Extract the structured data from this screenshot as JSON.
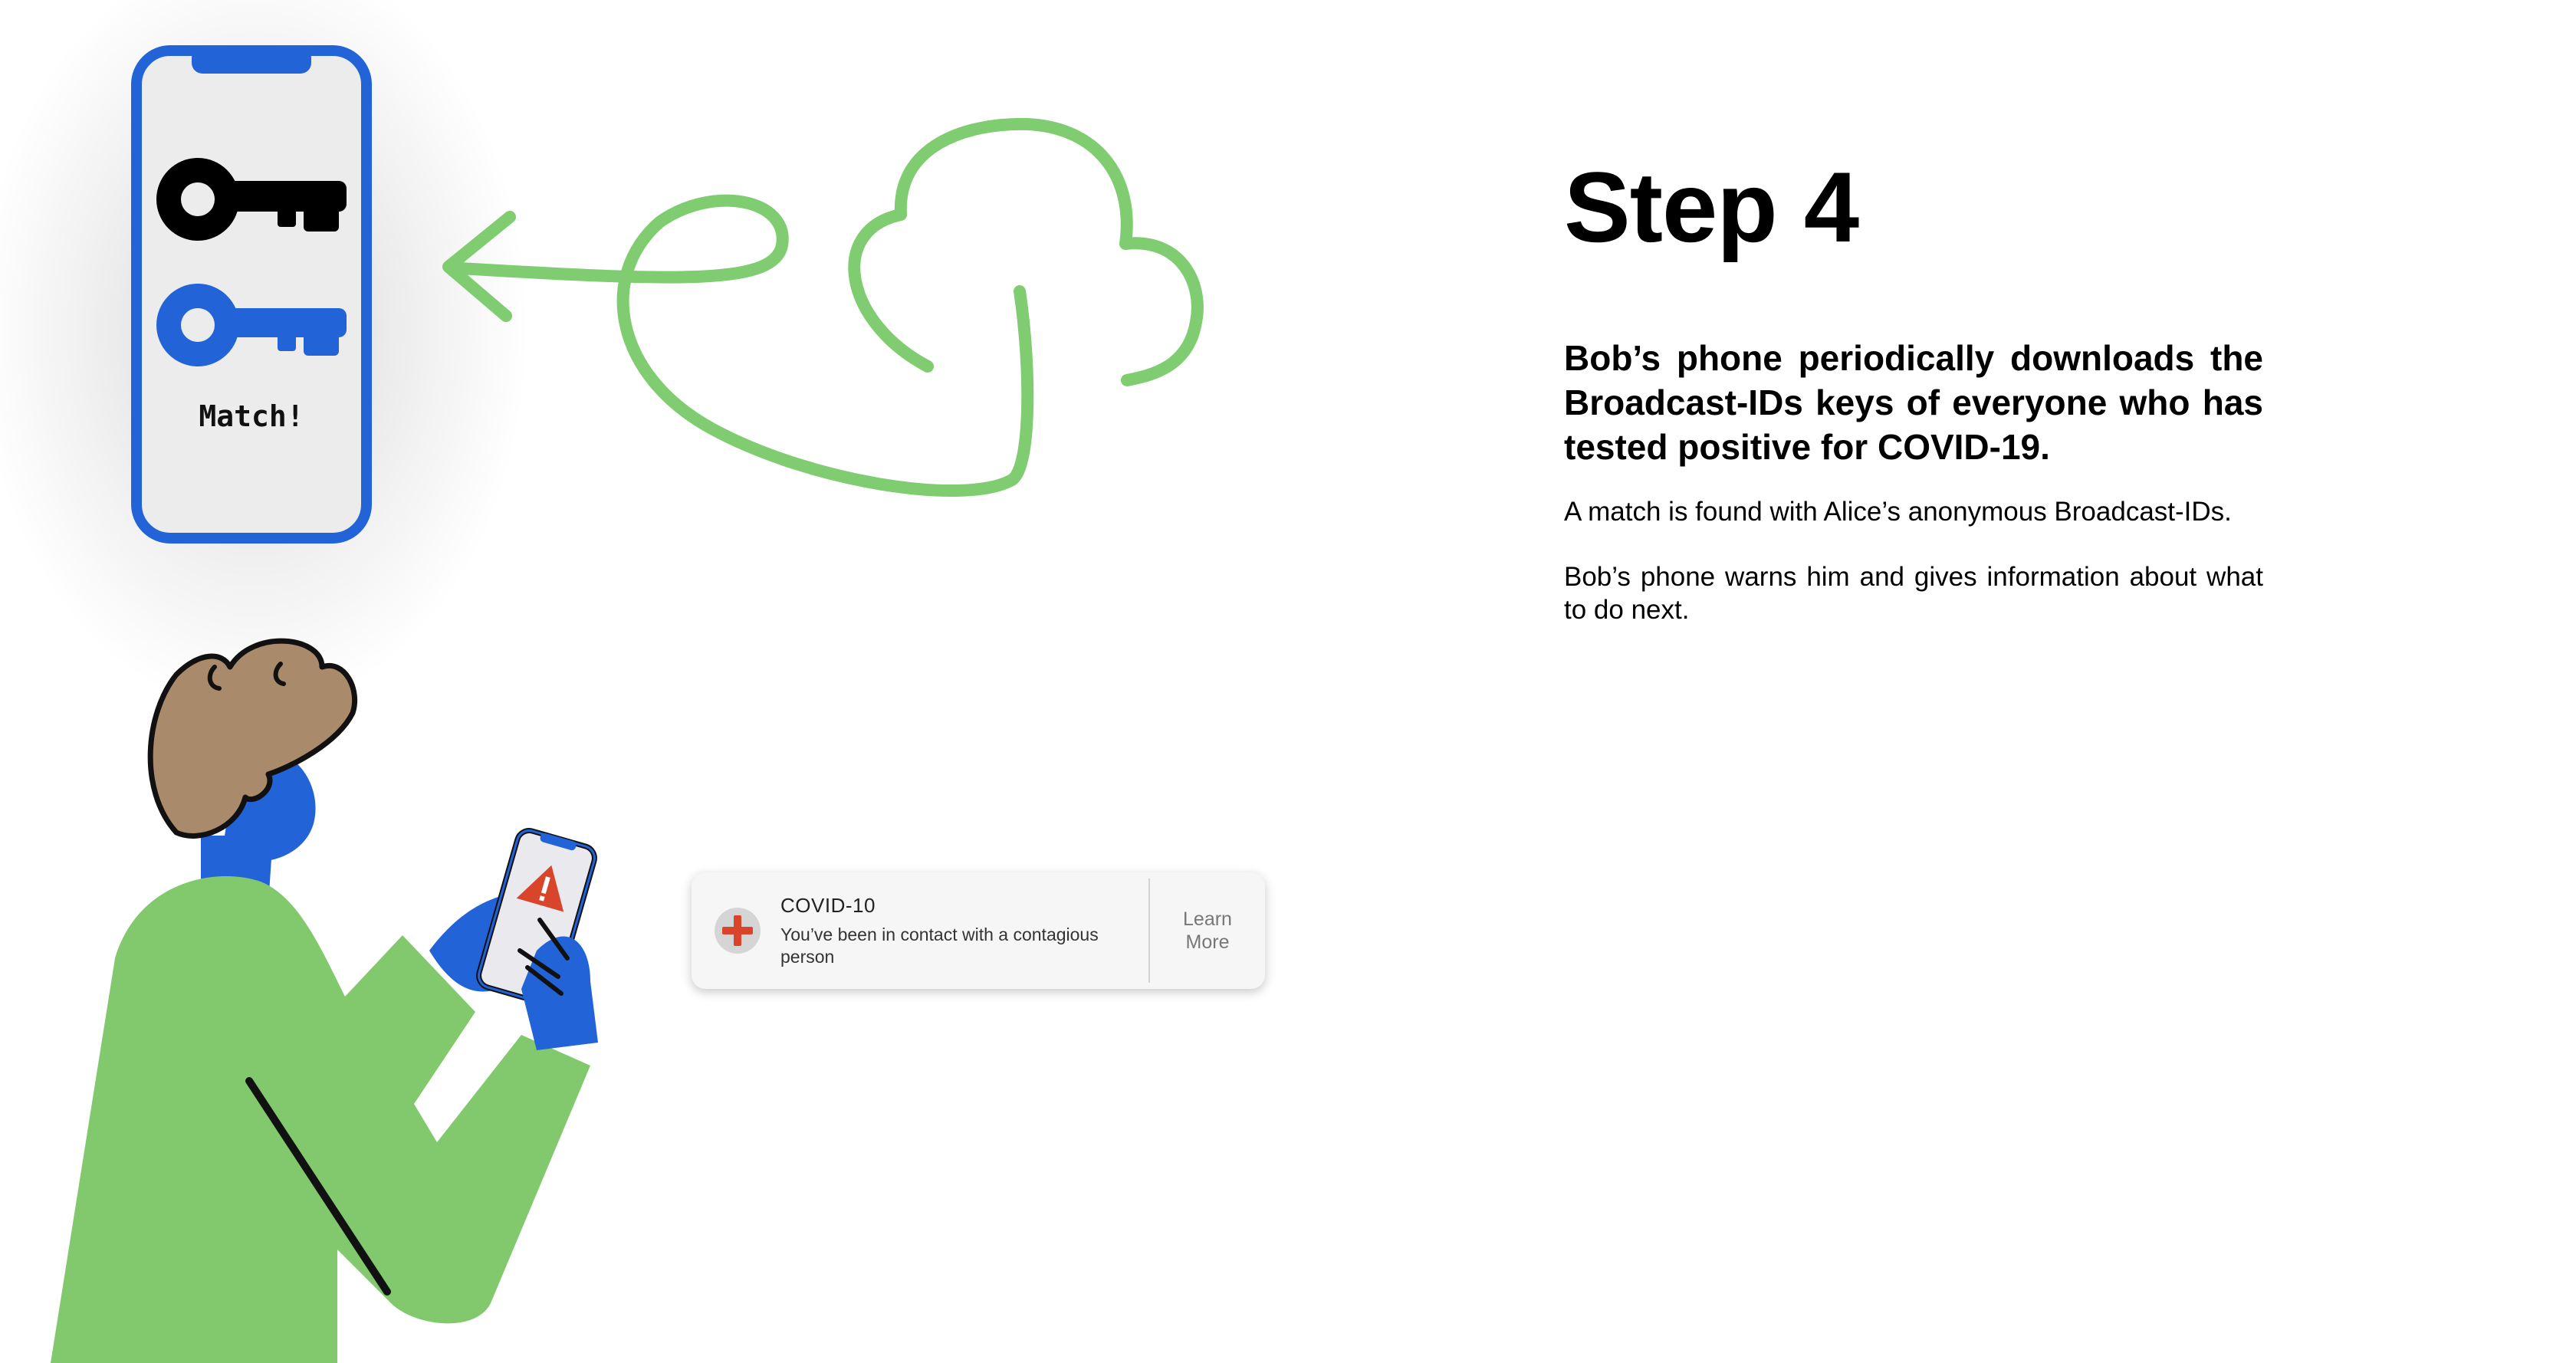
{
  "step_title": "Step 4",
  "lead": "Bob’s phone periodically downloads the Broadcast-IDs keys of everyone who has tested positive for COVID-19.",
  "paragraphs": [
    "A match is found with Alice’s anonymous Broadcast-IDs.",
    "Bob’s phone warns him and gives information about what to do next."
  ],
  "phone_screen": {
    "match_label": "Match!"
  },
  "notification": {
    "title": "COVID-10",
    "body": "You’ve been in contact with a contagious person",
    "action_label_line1": "Learn",
    "action_label_line2": "More"
  },
  "colors": {
    "accent_blue": "#2363d8",
    "cloud_green": "#7fcc71",
    "shirt_green": "#82c96e",
    "hair_brown": "#a98a6b",
    "alert_red": "#d8452b"
  },
  "icons": [
    "key-icon",
    "cloud-icon",
    "arrow-icon",
    "warning-icon",
    "plus-icon"
  ]
}
